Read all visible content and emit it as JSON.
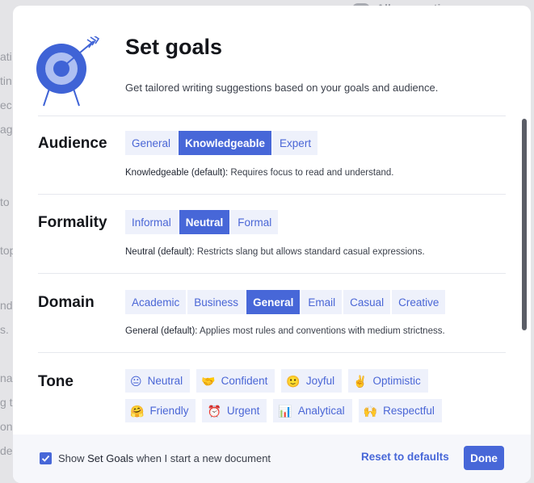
{
  "background_page": {
    "top_label": "All suggestions",
    "left_fragments": [
      "ati",
      "tin",
      "ec",
      "ag",
      "to",
      "top",
      "nd",
      "s.",
      "nal",
      "g t",
      "on",
      "de"
    ]
  },
  "modal": {
    "title": "Set goals",
    "subtitle": "Get tailored writing suggestions based on your goals and audience.",
    "illustration": "target-with-arrow-icon"
  },
  "sections": {
    "audience": {
      "title": "Audience",
      "options": [
        "General",
        "Knowledgeable",
        "Expert"
      ],
      "selected": "Knowledgeable",
      "desc_strong": "Knowledgeable (default):",
      "desc": " Requires focus to read and understand."
    },
    "formality": {
      "title": "Formality",
      "options": [
        "Informal",
        "Neutral",
        "Formal"
      ],
      "selected": "Neutral",
      "desc_strong": "Neutral (default):",
      "desc": " Restricts slang but allows standard casual expressions."
    },
    "domain": {
      "title": "Domain",
      "options": [
        "Academic",
        "Business",
        "General",
        "Email",
        "Casual",
        "Creative"
      ],
      "selected": "General",
      "desc_strong": "General (default):",
      "desc": " Applies most rules and conventions with medium strictness."
    },
    "tone": {
      "title": "Tone",
      "options": [
        {
          "label": "Neutral",
          "emoji": "😐",
          "icon": "neutral-face-icon"
        },
        {
          "label": "Confident",
          "emoji": "🤝",
          "icon": "handshake-icon"
        },
        {
          "label": "Joyful",
          "emoji": "🙂",
          "icon": "smile-icon"
        },
        {
          "label": "Optimistic",
          "emoji": "✌️",
          "icon": "victory-hand-icon"
        },
        {
          "label": "Friendly",
          "emoji": "🤗",
          "icon": "hugging-face-icon"
        },
        {
          "label": "Urgent",
          "emoji": "⏰",
          "icon": "alarm-clock-icon"
        },
        {
          "label": "Analytical",
          "emoji": "📊",
          "icon": "bar-chart-icon"
        },
        {
          "label": "Respectful",
          "emoji": "🙌",
          "icon": "raised-hands-icon"
        }
      ]
    }
  },
  "footer": {
    "checkbox_checked": true,
    "checkbox_label_pre": "Show ",
    "checkbox_label_hl": "Set Goals",
    "checkbox_label_post": " when I start a new document",
    "reset_label": "Reset to defaults",
    "done_label": "Done"
  },
  "colors": {
    "accent": "#4767d8",
    "pill_bg": "#eef1fb",
    "pill_text": "#4a66d6",
    "target_blue": "#3f63d6",
    "target_light": "#aebff2"
  }
}
